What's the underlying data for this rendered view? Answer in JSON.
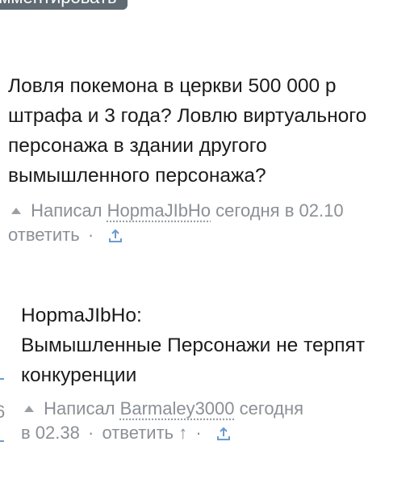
{
  "top_button": {
    "label": "омментировать"
  },
  "comment1": {
    "lines": [
      "Ловля покемона в церкви 500 000 р",
      "штрафа и 3 года? Ловлю виртуального",
      "персонажа в здании другого",
      "вымышленного персонажа?"
    ],
    "meta": {
      "written_label": "Написал",
      "author": "HopmaJIbHo",
      "time": "сегодня в 02.10",
      "reply_label": "ответить",
      "separator": "·",
      "share_icon": "share-icon"
    }
  },
  "comment2": {
    "lines": [
      "HopmaJIbHo:",
      "Вымышленные Персонажи не терпят",
      "конкуренции"
    ],
    "meta": {
      "written_label": "Написал",
      "author": "Barmaley3000",
      "time_line1": "сегодня",
      "time_line2": "в 02.38",
      "separator": "·",
      "reply_label": "ответить",
      "up_arrow": "↑",
      "share_icon": "share-icon"
    }
  },
  "left_edge": {
    "digit": "6"
  },
  "colors": {
    "meta_gray": "#8b9096",
    "button_bg": "#5f6a73",
    "thread_blue": "#6a9bd1"
  }
}
